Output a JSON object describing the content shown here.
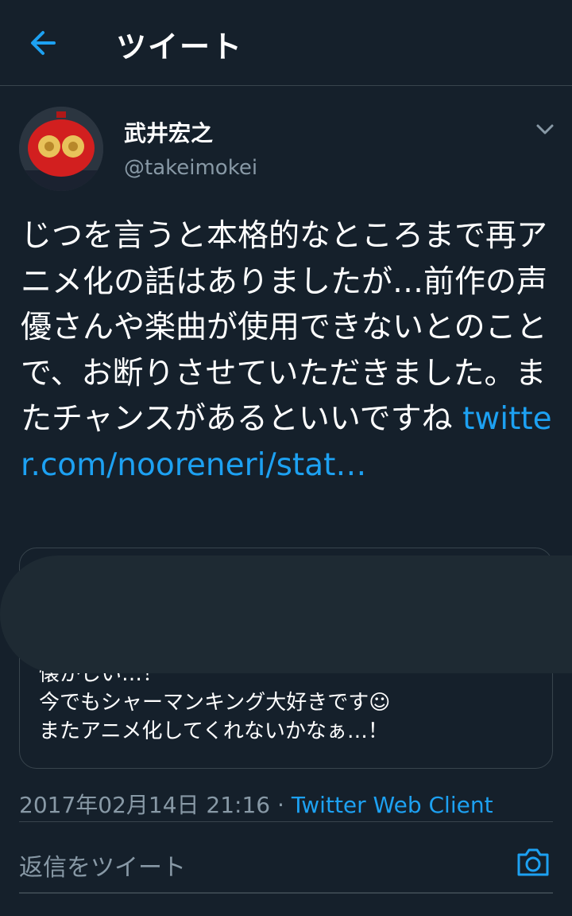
{
  "header": {
    "title": "ツイート",
    "back_icon": "back-arrow-icon"
  },
  "tweet": {
    "author_name": "武井宏之",
    "author_handle": "@takeimokei",
    "text": "じつを言うと本格的なところまで再アニメ化の話はありましたが…前作の声優さんや楽曲が使用できないとのことで、お断りさせていただきました。またチャンスがあるといいですね ",
    "link_text": "twitter.com/nooreneri/stat…",
    "timestamp": "2017年02月14日 21:16",
    "separator": " · ",
    "client": "Twitter Web Client"
  },
  "quote": {
    "text": "懐かしい…！\n今でもシャーマンキング大好きです☺\nまたアニメ化してくれないかなぁ…！"
  },
  "reply": {
    "placeholder": "返信をツイート",
    "camera_icon": "camera-icon"
  },
  "colors": {
    "background": "#15202b",
    "accent": "#1da1f2",
    "secondary_text": "#8899a6",
    "border": "#38444d"
  }
}
